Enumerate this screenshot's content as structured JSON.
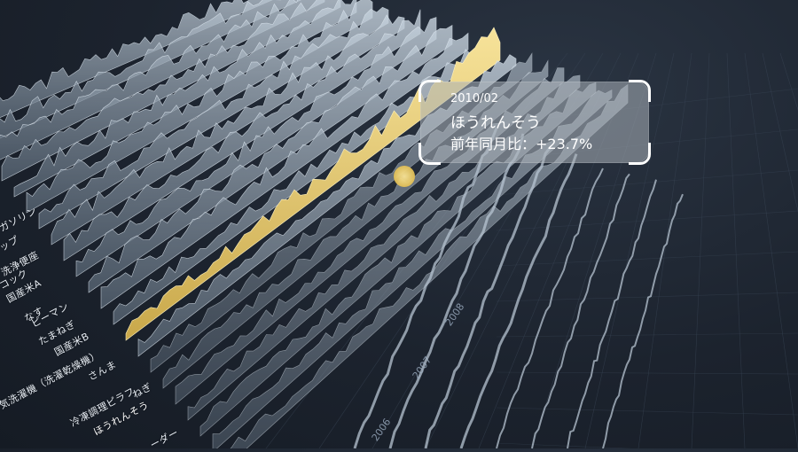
{
  "tooltip": {
    "date": "2010/02",
    "item": "ほうれんそう",
    "ratio_label": "前年同月比：",
    "ratio_value": "+23.7%"
  },
  "row_labels": [
    "ガソリン",
    "ップ",
    "洗浄便座",
    "コック",
    "国産米A",
    "なす",
    "ピーマン",
    "たまねぎ",
    "国産米B",
    "気洗濯機（洗濯乾燥機）",
    "さんま",
    "冷凍調理ピラフ",
    "ねぎ",
    "ほうれんそう",
    "ーダー"
  ],
  "year_labels": [
    "2006",
    "2007",
    "2008"
  ],
  "highlight_series": "ほうれんそう",
  "colors": {
    "background": "#1c232e",
    "ridge": "#a9b8c6",
    "highlight": "#e9d27a",
    "marker": "#f2d46b"
  }
}
